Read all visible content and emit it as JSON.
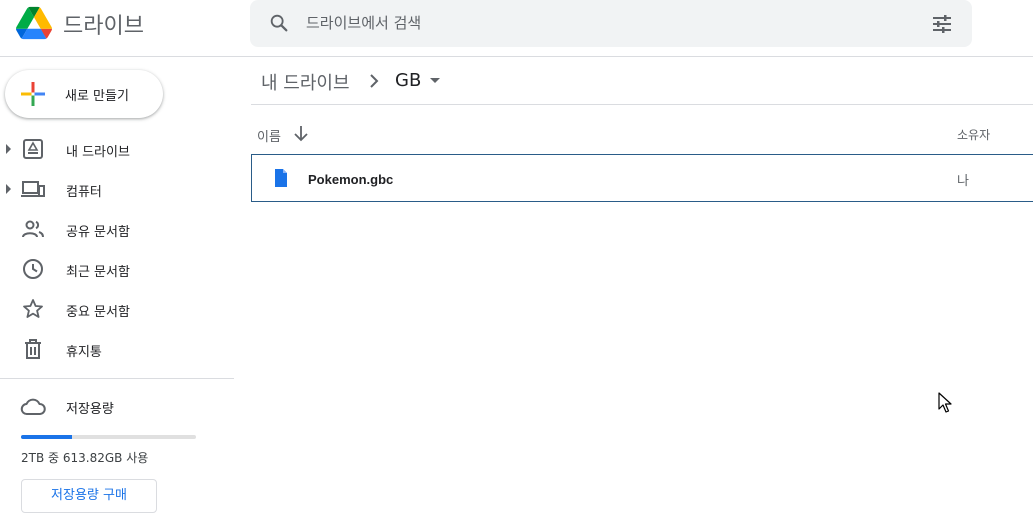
{
  "header": {
    "app_name": "드라이브",
    "search_placeholder": "드라이브에서 검색"
  },
  "new_button": {
    "label": "새로 만들기"
  },
  "sidebar": {
    "items": [
      {
        "label": "내 드라이브",
        "icon": "my-drive-icon",
        "expandable": true
      },
      {
        "label": "컴퓨터",
        "icon": "computers-icon",
        "expandable": true
      },
      {
        "label": "공유 문서함",
        "icon": "shared-icon",
        "expandable": false
      },
      {
        "label": "최근 문서함",
        "icon": "recent-clock-icon",
        "expandable": false
      },
      {
        "label": "중요 문서함",
        "icon": "star-icon",
        "expandable": false
      },
      {
        "label": "휴지통",
        "icon": "trash-icon",
        "expandable": false
      }
    ]
  },
  "storage": {
    "label": "저장용량",
    "usage_text": "2TB 중 613.82GB 사용",
    "used_fraction": 0.29,
    "buy_label": "저장용량 구매"
  },
  "breadcrumb": {
    "root": "내 드라이브",
    "current": "GB"
  },
  "columns": {
    "name": "이름",
    "owner": "소유자"
  },
  "files": [
    {
      "name": "Pokemon.gbc",
      "owner": "나",
      "icon": "document-file-icon"
    }
  ],
  "colors": {
    "accent": "#1a73e8",
    "selected_border": "#2a5c88",
    "text_secondary": "#5f6368"
  }
}
